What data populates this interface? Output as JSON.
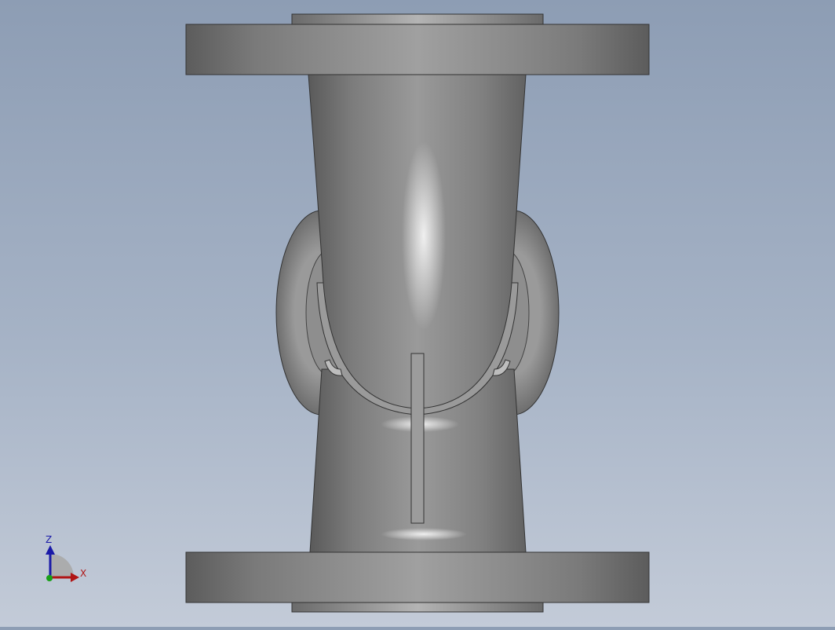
{
  "viewport": {
    "background_top": "#8d9db4",
    "background_bottom": "#c3cbd8",
    "model": "valve-body",
    "metal_color": "#8a8a8a"
  },
  "triad": {
    "z_label": "Z",
    "x_label": "X",
    "z_color": "#1a1aa8",
    "x_color": "#b01515",
    "y_color": "#18a018"
  }
}
